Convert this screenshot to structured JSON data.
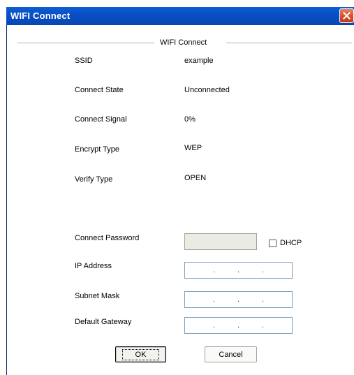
{
  "window": {
    "title": "WIFI Connect"
  },
  "group": {
    "title": "WIFI Connect"
  },
  "info": {
    "ssid_label": "SSID",
    "ssid_value": "example",
    "state_label": "Connect State",
    "state_value": "Unconnected",
    "signal_label": "Connect Signal",
    "signal_value": "0%",
    "encrypt_label": "Encrypt Type",
    "encrypt_value": "WEP",
    "verify_label": "Verify Type",
    "verify_value": "OPEN"
  },
  "form": {
    "password_label": "Connect Password",
    "password_value": "",
    "dhcp_label": "DHCP",
    "dhcp_checked": false,
    "ip_label": "IP Address",
    "subnet_label": "Subnet Mask",
    "gateway_label": "Default Gateway",
    "ip_separator": "."
  },
  "buttons": {
    "ok_label": "OK",
    "cancel_label": "Cancel"
  },
  "colors": {
    "titlebar": "#0a4fc4",
    "close_button": "#d8512c"
  }
}
